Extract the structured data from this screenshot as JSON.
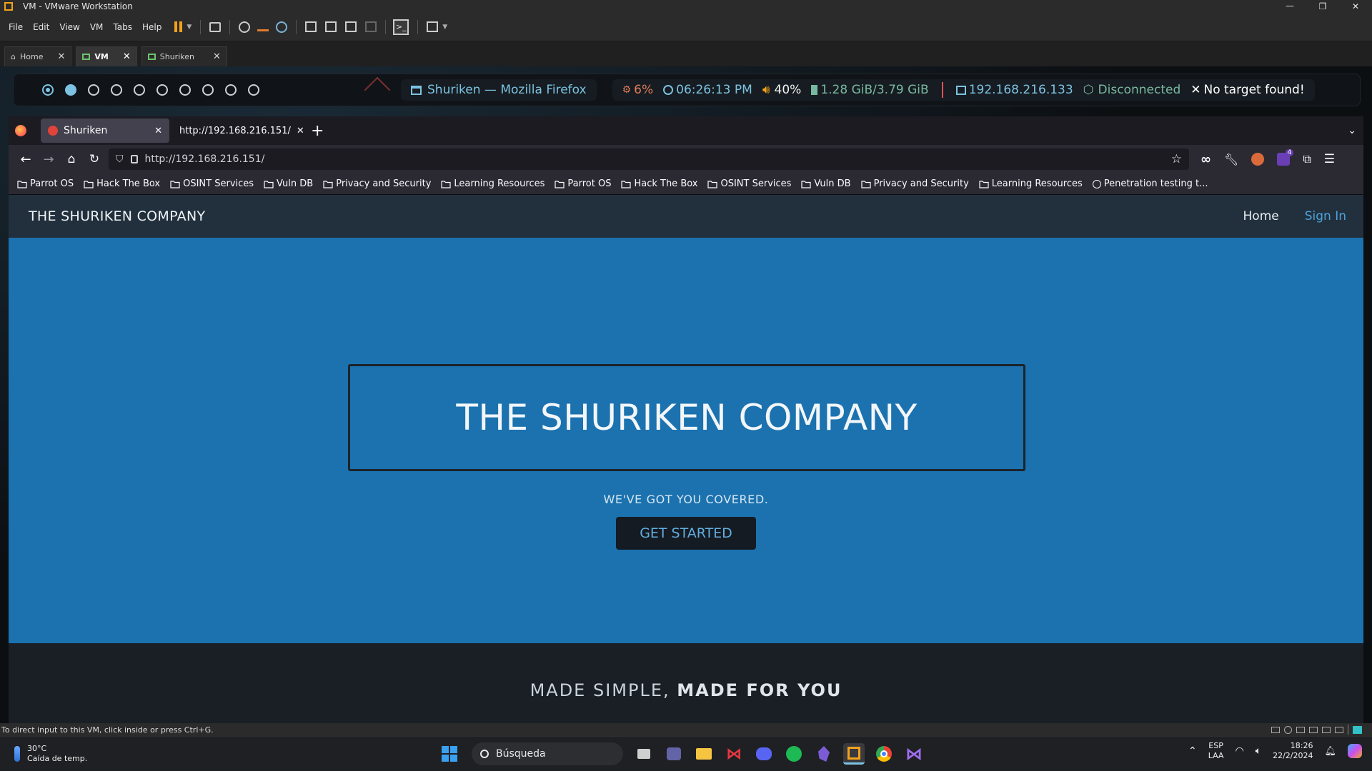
{
  "vmware": {
    "window_title": "VM - VMware Workstation",
    "menu": [
      "File",
      "Edit",
      "View",
      "VM",
      "Tabs",
      "Help"
    ],
    "tabs": [
      {
        "label": "Home",
        "active": false
      },
      {
        "label": "VM",
        "active": true
      },
      {
        "label": "Shuriken",
        "active": false
      }
    ],
    "status_text": "To direct input to this VM, click inside or press Ctrl+G."
  },
  "polybar": {
    "workspaces": 10,
    "active_workspace": 2,
    "window_title": "Shuriken — Mozilla Firefox",
    "cpu": "6%",
    "time": "06:26:13 PM",
    "volume": "40%",
    "memory": "1.28 GiB/3.79 GiB",
    "ip": "192.168.216.133",
    "vpn": "Disconnected",
    "target": "No target found!",
    "colors": {
      "accent": "#7cc3e3",
      "disconnected": "#79b8a0",
      "red": "#e05252"
    }
  },
  "firefox": {
    "tabs": [
      {
        "label": "Shuriken",
        "active": true
      },
      {
        "label": "http://192.168.216.151/",
        "active": false
      }
    ],
    "url": "http://192.168.216.151/",
    "bookmarks": [
      {
        "label": "Parrot OS"
      },
      {
        "label": "Hack The Box"
      },
      {
        "label": "OSINT Services"
      },
      {
        "label": "Vuln DB"
      },
      {
        "label": "Privacy and Security"
      },
      {
        "label": "Learning Resources"
      },
      {
        "label": "Parrot OS"
      },
      {
        "label": "Hack The Box"
      },
      {
        "label": "OSINT Services"
      },
      {
        "label": "Vuln DB"
      },
      {
        "label": "Privacy and Security"
      },
      {
        "label": "Learning Resources"
      },
      {
        "label": "Penetration testing t..."
      }
    ],
    "badge_count": "4"
  },
  "site": {
    "brand": "THE SHURIKEN COMPANY",
    "nav": {
      "home": "Home",
      "sign_in": "Sign In"
    },
    "hero_title": "THE SHURIKEN COMPANY",
    "tagline": "WE'VE GOT YOU COVERED.",
    "cta": "GET STARTED",
    "section_title_light": "MADE SIMPLE, ",
    "section_title_bold": "MADE FOR YOU",
    "colors": {
      "hero_bg": "#1b72af",
      "nav_bg": "#22303d",
      "link": "#63aee0"
    }
  },
  "taskbar": {
    "weather_temp": "30°C",
    "weather_desc": "Caída de temp.",
    "search_label": "Búsqueda",
    "lang_top": "ESP",
    "lang_bottom": "LAA",
    "clock_time": "18:26",
    "clock_date": "22/2/2024"
  }
}
